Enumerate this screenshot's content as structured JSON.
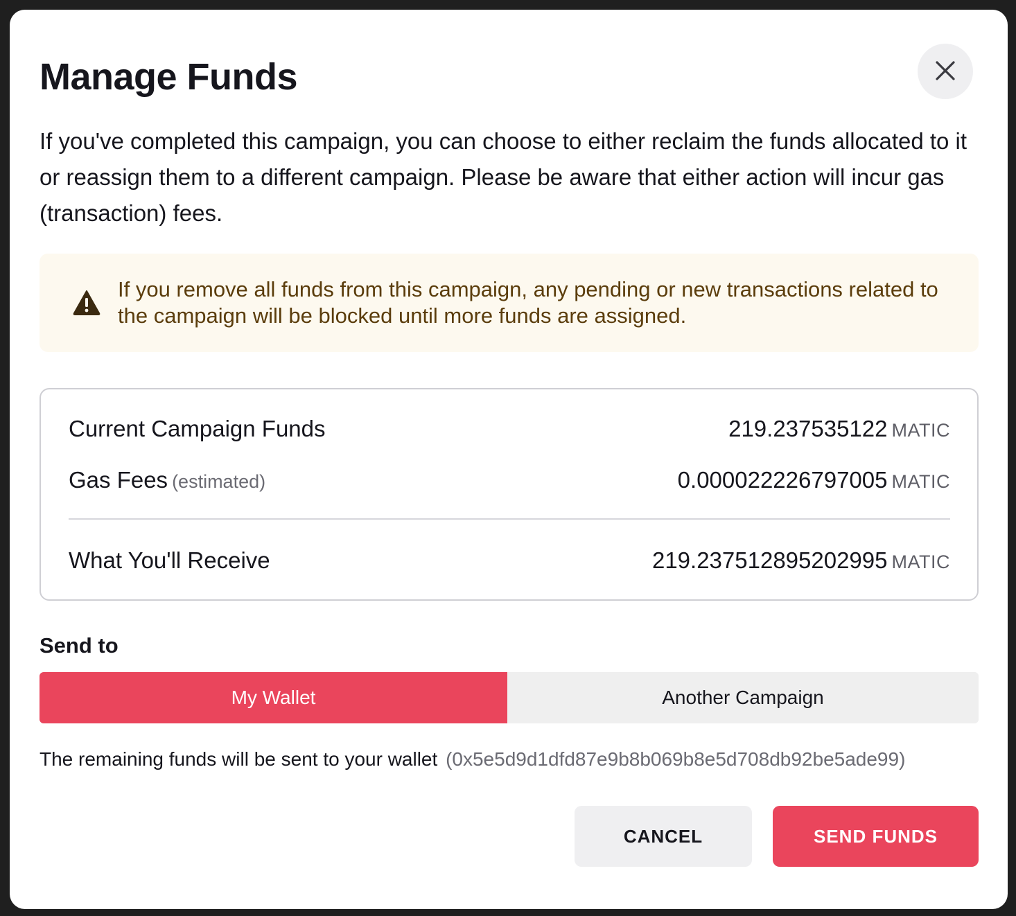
{
  "dialog": {
    "title": "Manage Funds",
    "intro": "If you've completed this campaign, you can choose to either reclaim the funds allocated to it or reassign them to a different campaign. Please be aware that either action will incur gas (transaction) fees.",
    "close_icon": "close-icon"
  },
  "warning": {
    "icon": "warning-triangle-icon",
    "text": "If you remove all funds from this campaign, any pending or new transactions related to the campaign will be blocked until more funds are assigned.",
    "accent_color": "#5b3d0c",
    "background_color": "#fdf9ef"
  },
  "summary": {
    "current_funds": {
      "label": "Current Campaign Funds",
      "value": "219.237535122",
      "unit": "MATIC"
    },
    "gas_fees": {
      "label": "Gas Fees",
      "sublabel": "(estimated)",
      "value": "0.000022226797005",
      "unit": "MATIC"
    },
    "receive": {
      "label": "What You'll Receive",
      "value": "219.237512895202995",
      "unit": "MATIC"
    }
  },
  "send_to": {
    "label": "Send to",
    "options": [
      {
        "label": "My Wallet",
        "selected": true
      },
      {
        "label": "Another Campaign",
        "selected": false
      }
    ],
    "wallet_message": "The remaining funds will be sent to your wallet",
    "wallet_address": "(0x5e5d9d1dfd87e9b8b069b8e5d708db92be5ade99)"
  },
  "actions": {
    "cancel_label": "CANCEL",
    "send_label": "SEND FUNDS"
  },
  "colors": {
    "accent": "#ea455c",
    "neutral_button": "#efeff1"
  }
}
